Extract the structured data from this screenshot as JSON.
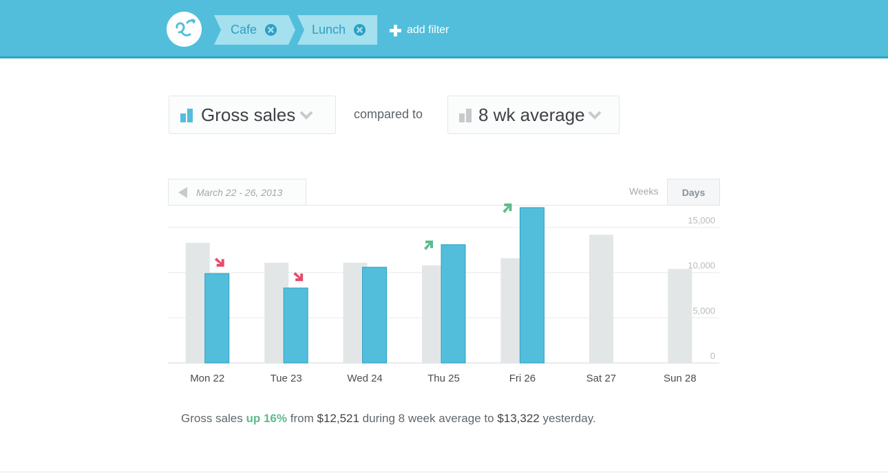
{
  "header": {
    "filters": [
      {
        "label": "Cafe"
      },
      {
        "label": "Lunch"
      }
    ],
    "add_filter_label": "add filter",
    "icons": {
      "logo": "brand-swirl-logo",
      "remove": "x-circle-icon",
      "add": "plus-icon"
    }
  },
  "controls": {
    "metric": {
      "label": "Gross sales",
      "icon": "bar-chart-icon",
      "caret": "chevron-down-icon"
    },
    "compared_to": "compared to",
    "comparison": {
      "label": "8 wk average",
      "icon": "bar-chart-icon",
      "caret": "chevron-down-icon"
    }
  },
  "range": {
    "label": "March 22 - 26, 2013",
    "prev_icon": "triangle-left-icon"
  },
  "views": {
    "weeks": "Weeks",
    "days": "Days",
    "selected": "Days"
  },
  "colors": {
    "header": "#52bedb",
    "actual_bar": "#52bedb",
    "average_bar": "#e3e6e6",
    "up": "#5ebb8e",
    "down": "#e84a6c"
  },
  "chart_data": {
    "type": "bar",
    "categories": [
      "Mon 22",
      "Tue 23",
      "Wed 24",
      "Thu 25",
      "Fri 26",
      "Sat 27",
      "Sun 28"
    ],
    "series": [
      {
        "values": [
          13300,
          11100,
          11100,
          10800,
          11600,
          14200,
          10400
        ]
      },
      {
        "values": [
          9900,
          8300,
          10600,
          13100,
          17200,
          null,
          null
        ]
      }
    ],
    "trend": [
      "down",
      "down",
      null,
      "up",
      "up",
      null,
      null
    ],
    "yticks": [
      0,
      5000,
      10000,
      15000
    ],
    "ytick_labels": [
      "0",
      "5,000",
      "10,000",
      "15,000"
    ],
    "ylim": [
      0,
      17500
    ],
    "grid": true,
    "y_axis_position": "right"
  },
  "summary": {
    "lead": "Gross sales",
    "change": "up 16%",
    "from": "from",
    "from_value": "$12,521",
    "mid": "during 8 week average to",
    "to_value": "$13,322",
    "tail": "yesterday."
  }
}
